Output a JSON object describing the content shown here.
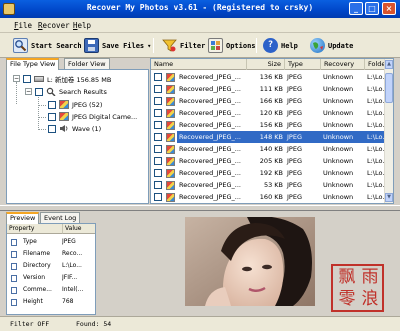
{
  "window": {
    "title": "Recover My Photos v3.61  - (Registered to crsky)"
  },
  "menu": {
    "items": [
      "File",
      "Recover",
      "Help"
    ]
  },
  "toolbar": {
    "start_search": "Start Search",
    "save_files": "Save Files",
    "save_files_dropdown": "▾",
    "filter": "Filter",
    "options": "Options",
    "help": "Help",
    "update": "Update"
  },
  "left_panel": {
    "tabs": [
      "File Type View",
      "Folder View"
    ],
    "active_tab": "File Type View",
    "tree": {
      "drive_label": "L: 新加卷  156.85 MB",
      "search_results": "Search Results",
      "jpeg": "JPEG (52)",
      "jpeg_camera": "JPEG Digital Came...",
      "wave": "Wave (1)"
    }
  },
  "file_list": {
    "columns": [
      "Name",
      "Size",
      "Type",
      "Recovery",
      "Folder"
    ],
    "rows": [
      {
        "name": "Recovered_JPEG_...",
        "size": "136 KB",
        "type": "JPEG",
        "recovery": "Unknown",
        "folder": "L:\\Lo...",
        "selected": false
      },
      {
        "name": "Recovered_JPEG_...",
        "size": "111 KB",
        "type": "JPEG",
        "recovery": "Unknown",
        "folder": "L:\\Lo...",
        "selected": false
      },
      {
        "name": "Recovered_JPEG_...",
        "size": "166 KB",
        "type": "JPEG",
        "recovery": "Unknown",
        "folder": "L:\\Lo...",
        "selected": false
      },
      {
        "name": "Recovered_JPEG_...",
        "size": "120 KB",
        "type": "JPEG",
        "recovery": "Unknown",
        "folder": "L:\\Lo...",
        "selected": false
      },
      {
        "name": "Recovered_JPEG_...",
        "size": "156 KB",
        "type": "JPEG",
        "recovery": "Unknown",
        "folder": "L:\\Lo...",
        "selected": false
      },
      {
        "name": "Recovered_JPEG_...",
        "size": "148 KB",
        "type": "JPEG",
        "recovery": "Unknown",
        "folder": "L:\\Lo...",
        "selected": true
      },
      {
        "name": "Recovered_JPEG_...",
        "size": "140 KB",
        "type": "JPEG",
        "recovery": "Unknown",
        "folder": "L:\\Lo...",
        "selected": false
      },
      {
        "name": "Recovered_JPEG_...",
        "size": "205 KB",
        "type": "JPEG",
        "recovery": "Unknown",
        "folder": "L:\\Lo...",
        "selected": false
      },
      {
        "name": "Recovered_JPEG_...",
        "size": "192 KB",
        "type": "JPEG",
        "recovery": "Unknown",
        "folder": "L:\\Lo...",
        "selected": false
      },
      {
        "name": "Recovered_JPEG_...",
        "size": "53 KB",
        "type": "JPEG",
        "recovery": "Unknown",
        "folder": "L:\\Lo...",
        "selected": false
      },
      {
        "name": "Recovered_JPEG_...",
        "size": "160 KB",
        "type": "JPEG",
        "recovery": "Unknown",
        "folder": "L:\\Lo...",
        "selected": false
      }
    ]
  },
  "bottom_panel": {
    "tabs": [
      "Preview",
      "Event Log"
    ],
    "active_tab": "Preview",
    "property_header": "Property",
    "value_header": "Value",
    "properties": [
      {
        "key": "Type",
        "value": "JPEG"
      },
      {
        "key": "Filename",
        "value": "Reco..."
      },
      {
        "key": "Directory",
        "value": "L:\\Lo..."
      },
      {
        "key": "Version",
        "value": "JFIF..."
      },
      {
        "key": "Comme...",
        "value": "Intel(..."
      },
      {
        "key": "Height",
        "value": "768"
      }
    ]
  },
  "watermark": {
    "chars": [
      "飘",
      "雨",
      "零",
      "浪"
    ]
  },
  "status": {
    "filter": "Filter OFF",
    "found": "Found: 54"
  },
  "colors": {
    "titlebar": "#0046c8",
    "selection": "#316ac5",
    "watermark": "#c0312a"
  }
}
